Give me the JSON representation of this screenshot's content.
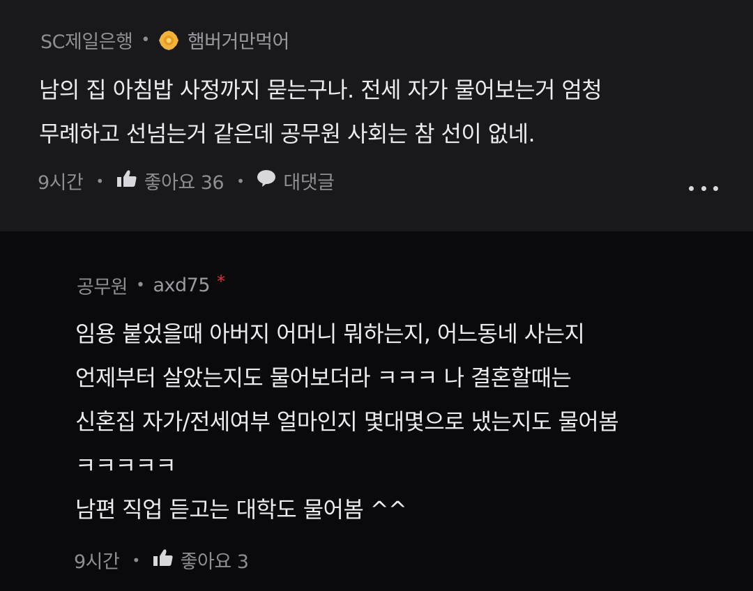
{
  "comment": {
    "company": "SC제일은행",
    "nickname": "햄버거만먹어",
    "lines": [
      "남의 집 아침밥 사정까지 묻는구나. 전세 자가 물어보는거 엄청",
      "무례하고 선넘는거 같은데 공무원 사회는 참 선이 없네."
    ],
    "time": "9시간",
    "like_label": "좋아요 36",
    "reply_label": "대댓글",
    "badge_icon": "gold-badge-icon",
    "like_icon": "thumbs-up-icon",
    "reply_icon": "speech-bubble-icon",
    "more_icon": "more-dots-icon"
  },
  "reply": {
    "company": "공무원",
    "nickname": "axd75",
    "author_mark": "*",
    "lines": [
      "임용 붙었을때 아버지 어머니 뭐하는지, 어느동네 사는지",
      "언제부터 살았는지도 물어보더라 ㅋㅋㅋ 나 결혼할때는",
      "신혼집 자가/전세여부 얼마인지 몇대몇으로 냈는지도 물어봄",
      "ㅋㅋㅋㅋㅋ",
      "남편 직업 듣고는 대학도 물어봄 ^^"
    ],
    "time": "9시간",
    "like_label": "좋아요 3",
    "like_icon": "thumbs-up-icon"
  },
  "colors": {
    "main_bg": "#19191b",
    "reply_bg": "#0a0a0c",
    "text": "#ececee",
    "muted": "#8e8e93",
    "badge": "#f2b33d",
    "author_mark": "#e0323c"
  }
}
